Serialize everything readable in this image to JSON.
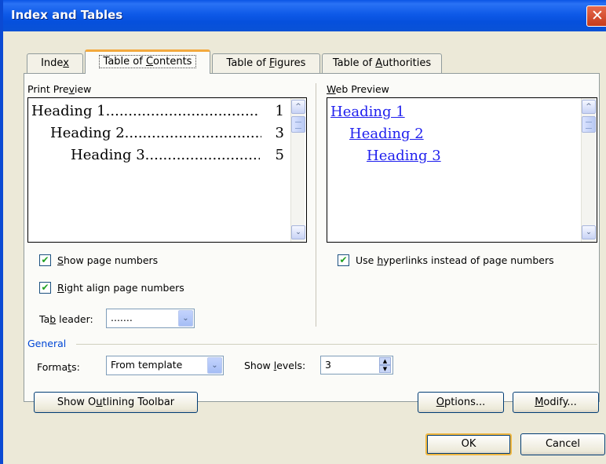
{
  "window": {
    "title": "Index and Tables",
    "close_glyph": "✕"
  },
  "tabs": [
    {
      "label_html": "Inde<u>x</u>"
    },
    {
      "label_html": "Table of <u>C</u>ontents"
    },
    {
      "label_html": "Table of <u>F</u>igures"
    },
    {
      "label_html": "Table of <u>A</u>uthorities"
    }
  ],
  "print_preview": {
    "label_html": "Print Pre<u>v</u>iew",
    "lines": [
      {
        "heading": "Heading 1",
        "page": "1"
      },
      {
        "heading": "Heading 2",
        "page": "3"
      },
      {
        "heading": "Heading 3",
        "page": "5"
      }
    ]
  },
  "web_preview": {
    "label_html": "<u>W</u>eb Preview",
    "lines": [
      "Heading 1",
      "Heading 2",
      "Heading 3"
    ]
  },
  "options": {
    "show_page_numbers_html": "<u>S</u>how page numbers",
    "right_align_html": "<u>R</u>ight align page numbers",
    "use_hyperlinks_html": "Use <u>h</u>yperlinks instead of page numbers",
    "tab_leader_html": "Ta<u>b</u> leader:",
    "tab_leader_value": ".......",
    "check_mark": "✔"
  },
  "general": {
    "group_label": "General",
    "formats_html": "Forma<u>t</u>s:",
    "formats_value": "From template",
    "show_levels_html": "Show <u>l</u>evels:",
    "show_levels_value": "3"
  },
  "buttons": {
    "outlining_html": "Show O<u>u</u>tlining Toolbar",
    "options_html": "<u>O</u>ptions...",
    "modify_html": "<u>M</u>odify...",
    "ok": "OK",
    "cancel": "Cancel"
  },
  "icons": {
    "scroll_up": "^",
    "scroll_down": "⌄",
    "combo_drop": "⌄",
    "spin_up": "▲",
    "spin_down": "▼"
  }
}
